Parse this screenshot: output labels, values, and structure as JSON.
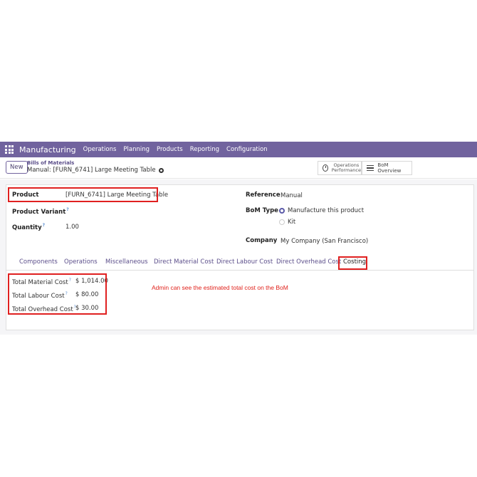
{
  "navbar": {
    "app_name": "Manufacturing",
    "menu": [
      "Operations",
      "Planning",
      "Products",
      "Reporting",
      "Configuration"
    ],
    "bg_color": "#71639e"
  },
  "control": {
    "new_label": "New",
    "breadcrumb_parent": "Bills of Materials",
    "breadcrumb_current": "Manual: [FURN_6741] Large Meeting Table",
    "smart_ops_line1": "Operations",
    "smart_ops_line2": "Performance",
    "smart_bom": "BoM Overview"
  },
  "form": {
    "product_label": "Product",
    "product_value": "[FURN_6741] Large Meeting Table",
    "variant_label": "Product Variant",
    "quantity_label": "Quantity",
    "quantity_value": "1.00",
    "reference_label": "Reference",
    "reference_value": "Manual",
    "bomtype_label": "BoM Type",
    "bomtype_opt1": "Manufacture this product",
    "bomtype_opt2": "Kit",
    "company_label": "Company",
    "company_value": "My Company (San Francisco)",
    "help_mark": "?"
  },
  "tabs": [
    "Components",
    "Operations",
    "Miscellaneous",
    "Direct Material Cost",
    "Direct Labour Cost",
    "Direct Overhead Cost",
    "Costing"
  ],
  "costing": {
    "material_label": "Total Material Cost",
    "material_value": "$ 1,014.00",
    "labour_label": "Total Labour Cost",
    "labour_value": "$ 80.00",
    "overhead_label": "Total Overhead Cost",
    "overhead_value": "$ 30.00"
  },
  "annotation": "Admin can see the estimated total cost on the BoM",
  "highlight_color": "#e02020"
}
